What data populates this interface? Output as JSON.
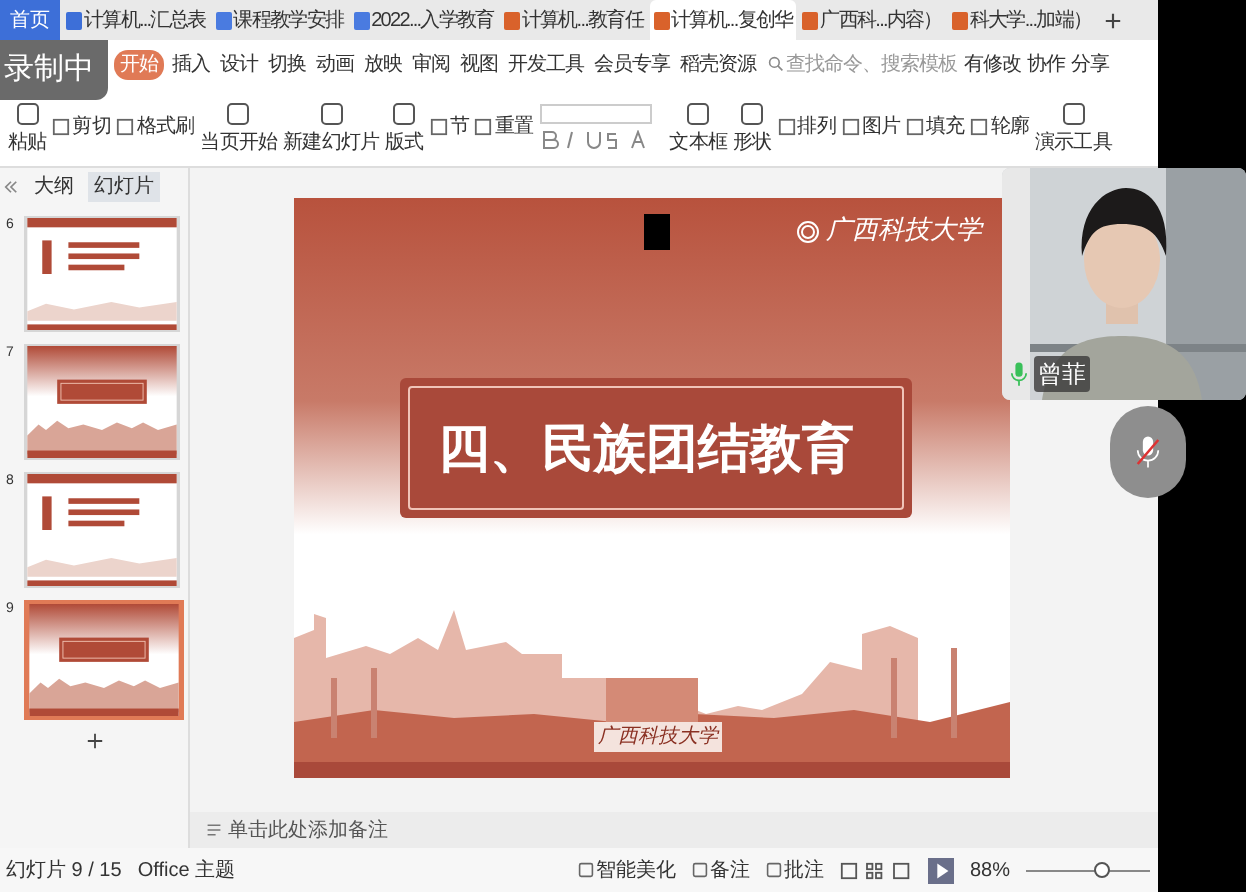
{
  "recording": {
    "label": "录制中"
  },
  "tabs": [
    {
      "label": "首页",
      "kind": "home",
      "selected": false
    },
    {
      "label": "计算机...汇总表",
      "kind": "sheet",
      "selected": false
    },
    {
      "label": "课程教学安排",
      "kind": "doc",
      "selected": false
    },
    {
      "label": "2022...入学教育",
      "kind": "doc",
      "selected": false
    },
    {
      "label": "计算机...教育任",
      "kind": "slides",
      "selected": false
    },
    {
      "label": "计算机...复创华",
      "kind": "slides",
      "selected": true
    },
    {
      "label": "广西科...内容）",
      "kind": "slides",
      "selected": false
    },
    {
      "label": "科大学...加端）",
      "kind": "slides",
      "selected": false
    }
  ],
  "menu": [
    {
      "label": "开始",
      "selected": true
    },
    {
      "label": "插入",
      "selected": false
    },
    {
      "label": "设计",
      "selected": false
    },
    {
      "label": "切换",
      "selected": false
    },
    {
      "label": "动画",
      "selected": false
    },
    {
      "label": "放映",
      "selected": false
    },
    {
      "label": "审阅",
      "selected": false
    },
    {
      "label": "视图",
      "selected": false
    },
    {
      "label": "开发工具",
      "selected": false
    },
    {
      "label": "会员专享",
      "selected": false
    },
    {
      "label": "稻壳资源",
      "selected": false
    }
  ],
  "search": {
    "placeholder": "查找命令、搜索模板"
  },
  "menu_actions": [
    "有修改",
    "协作",
    "分享"
  ],
  "toolbar": [
    {
      "label": "粘贴",
      "kind": "big"
    },
    {
      "label": "剪切",
      "kind": "small"
    },
    {
      "label": "格式刷",
      "kind": "small"
    },
    {
      "label": "当页开始",
      "kind": "big"
    },
    {
      "label": "新建幻灯片",
      "kind": "big"
    },
    {
      "label": "版式",
      "kind": "big"
    },
    {
      "label": "节",
      "kind": "small"
    },
    {
      "label": "重置",
      "kind": "small"
    },
    {
      "label": "文本框",
      "kind": "big"
    },
    {
      "label": "形状",
      "kind": "big"
    },
    {
      "label": "排列",
      "kind": "small"
    },
    {
      "label": "图片",
      "kind": "small"
    },
    {
      "label": "填充",
      "kind": "small"
    },
    {
      "label": "轮廓",
      "kind": "small"
    },
    {
      "label": "演示工具",
      "kind": "big"
    }
  ],
  "panel_tabs": [
    {
      "label": "大纲",
      "selected": false
    },
    {
      "label": "幻灯片",
      "selected": true
    }
  ],
  "thumbnails": [
    {
      "number": "6",
      "kind": "list",
      "selected": false
    },
    {
      "number": "7",
      "kind": "title",
      "selected": false
    },
    {
      "number": "8",
      "kind": "list",
      "selected": false
    },
    {
      "number": "9",
      "kind": "title",
      "selected": true
    }
  ],
  "slide": {
    "title": "四、民族团结教育",
    "logo": "广西科技大学",
    "sign": "广西科技大学"
  },
  "notes": {
    "placeholder": "单击此处添加备注"
  },
  "status_bar": {
    "slide": "幻灯片 9 / 15",
    "theme": "Office 主题",
    "items": [
      "智能美化",
      "备注",
      "批注"
    ],
    "zoom": "88%",
    "zoom_slider": {
      "level": 0.62
    }
  },
  "video": {
    "name": "曾菲",
    "mic_on": true
  }
}
